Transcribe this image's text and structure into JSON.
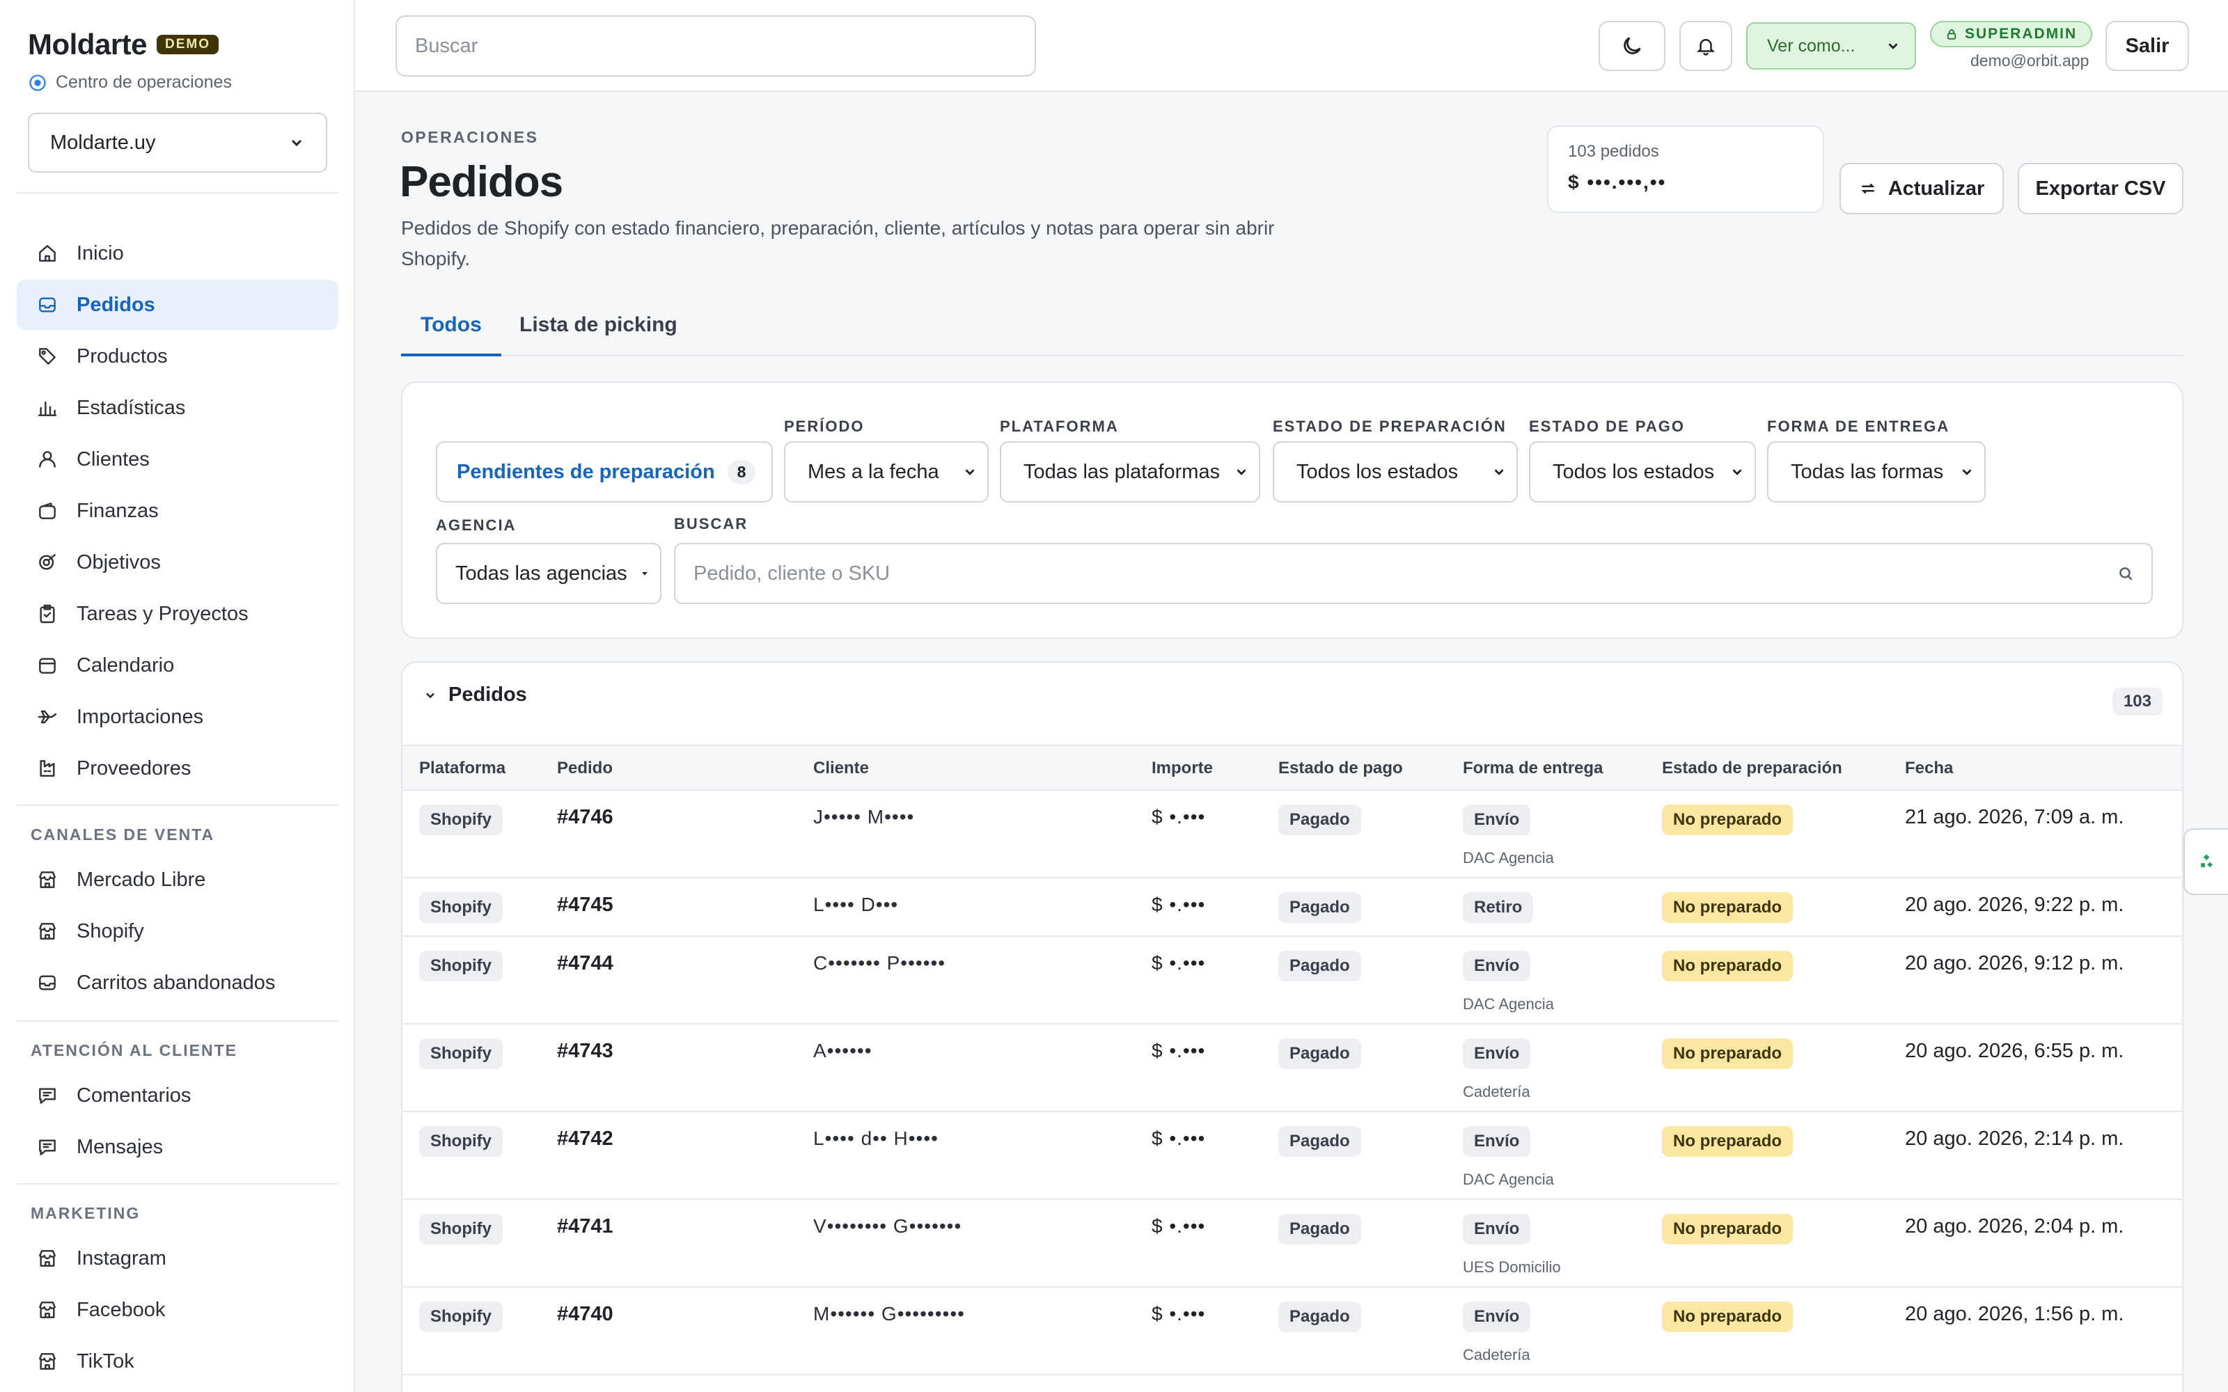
{
  "sidebar": {
    "brand": "Moldarte",
    "demo_badge": "DEMO",
    "subtitle": "Centro de operaciones",
    "org_select": "Moldarte.uy",
    "nav": [
      {
        "label": "Inicio",
        "icon": "home-icon"
      },
      {
        "label": "Pedidos",
        "icon": "inbox-icon",
        "active": true
      },
      {
        "label": "Productos",
        "icon": "tag-icon"
      },
      {
        "label": "Estadísticas",
        "icon": "bar-chart-icon"
      },
      {
        "label": "Clientes",
        "icon": "user-icon"
      },
      {
        "label": "Finanzas",
        "icon": "wallet-icon"
      },
      {
        "label": "Objetivos",
        "icon": "target-icon"
      },
      {
        "label": "Tareas y Proyectos",
        "icon": "clipboard-icon"
      },
      {
        "label": "Calendario",
        "icon": "calendar-icon"
      },
      {
        "label": "Importaciones",
        "icon": "plane-icon"
      },
      {
        "label": "Proveedores",
        "icon": "factory-icon"
      }
    ],
    "sales_title": "CANALES DE VENTA",
    "sales": [
      {
        "label": "Mercado Libre",
        "icon": "store-icon"
      },
      {
        "label": "Shopify",
        "icon": "store-icon"
      },
      {
        "label": "Carritos abandonados",
        "icon": "inbox-icon"
      }
    ],
    "support_title": "ATENCIÓN AL CLIENTE",
    "support": [
      {
        "label": "Comentarios",
        "icon": "message-icon"
      },
      {
        "label": "Mensajes",
        "icon": "message-icon"
      }
    ],
    "marketing_title": "MARKETING",
    "marketing": [
      {
        "label": "Instagram",
        "icon": "store-icon"
      },
      {
        "label": "Facebook",
        "icon": "store-icon"
      },
      {
        "label": "TikTok",
        "icon": "store-icon"
      }
    ]
  },
  "topbar": {
    "search_placeholder": "Buscar",
    "view_as": "Ver como...",
    "role": "SUPERADMIN",
    "email": "demo@orbit.app",
    "logout": "Salir"
  },
  "header": {
    "eyebrow": "OPERACIONES",
    "title": "Pedidos",
    "description": "Pedidos de Shopify con estado financiero, preparación, cliente, artículos y notas para operar sin abrir Shopify.",
    "summary_count": "103 pedidos",
    "summary_amount": "$ •••.•••,••",
    "refresh": "Actualizar",
    "export": "Exportar CSV"
  },
  "tabs": [
    "Todos",
    "Lista de picking"
  ],
  "filters": {
    "pending_label": "Pendientes de preparación",
    "pending_count": "8",
    "period_label": "PERÍODO",
    "period_value": "Mes a la fecha",
    "platform_label": "PLATAFORMA",
    "platform_value": "Todas las plataformas",
    "prep_label": "ESTADO DE PREPARACIÓN",
    "prep_value": "Todos los estados",
    "pay_label": "ESTADO DE PAGO",
    "pay_value": "Todos los estados",
    "delivery_label": "FORMA DE ENTREGA",
    "delivery_value": "Todas las formas",
    "agency_label": "AGENCIA",
    "agency_value": "Todas las agencias",
    "search_label": "BUSCAR",
    "search_placeholder": "Pedido, cliente o SKU"
  },
  "orders": {
    "title": "Pedidos",
    "total": "103",
    "columns": [
      "Plataforma",
      "Pedido",
      "Cliente",
      "Importe",
      "Estado de pago",
      "Forma de entrega",
      "Estado de preparación",
      "Fecha"
    ],
    "rows": [
      {
        "platform": "Shopify",
        "order": "#4746",
        "customer": "J••••• M••••",
        "amount": "$ •.•••",
        "payment": "Pagado",
        "delivery": "Envío",
        "agency": "DAC Agencia",
        "prep": "No preparado",
        "date": "21 ago. 2026, 7:09 a. m."
      },
      {
        "platform": "Shopify",
        "order": "#4745",
        "customer": "L•••• D•••",
        "amount": "$ •.•••",
        "payment": "Pagado",
        "delivery": "Retiro",
        "agency": "",
        "prep": "No preparado",
        "date": "20 ago. 2026, 9:22 p. m."
      },
      {
        "platform": "Shopify",
        "order": "#4744",
        "customer": "C••••••• P••••••",
        "amount": "$ •.•••",
        "payment": "Pagado",
        "delivery": "Envío",
        "agency": "DAC Agencia",
        "prep": "No preparado",
        "date": "20 ago. 2026, 9:12 p. m."
      },
      {
        "platform": "Shopify",
        "order": "#4743",
        "customer": "A••••••",
        "amount": "$ •.•••",
        "payment": "Pagado",
        "delivery": "Envío",
        "agency": "Cadetería",
        "prep": "No preparado",
        "date": "20 ago. 2026, 6:55 p. m."
      },
      {
        "platform": "Shopify",
        "order": "#4742",
        "customer": "L•••• d•• H••••",
        "amount": "$ •.•••",
        "payment": "Pagado",
        "delivery": "Envío",
        "agency": "DAC Agencia",
        "prep": "No preparado",
        "date": "20 ago. 2026, 2:14 p. m."
      },
      {
        "platform": "Shopify",
        "order": "#4741",
        "customer": "V•••••••• G•••••••",
        "amount": "$ •.•••",
        "payment": "Pagado",
        "delivery": "Envío",
        "agency": "UES Domicilio",
        "prep": "No preparado",
        "date": "20 ago. 2026, 2:04 p. m."
      },
      {
        "platform": "Shopify",
        "order": "#4740",
        "customer": "M•••••• G•••••••••",
        "amount": "$ •.•••",
        "payment": "Pagado",
        "delivery": "Envío",
        "agency": "Cadetería",
        "prep": "No preparado",
        "date": "20 ago. 2026, 1:56 p. m."
      }
    ]
  }
}
